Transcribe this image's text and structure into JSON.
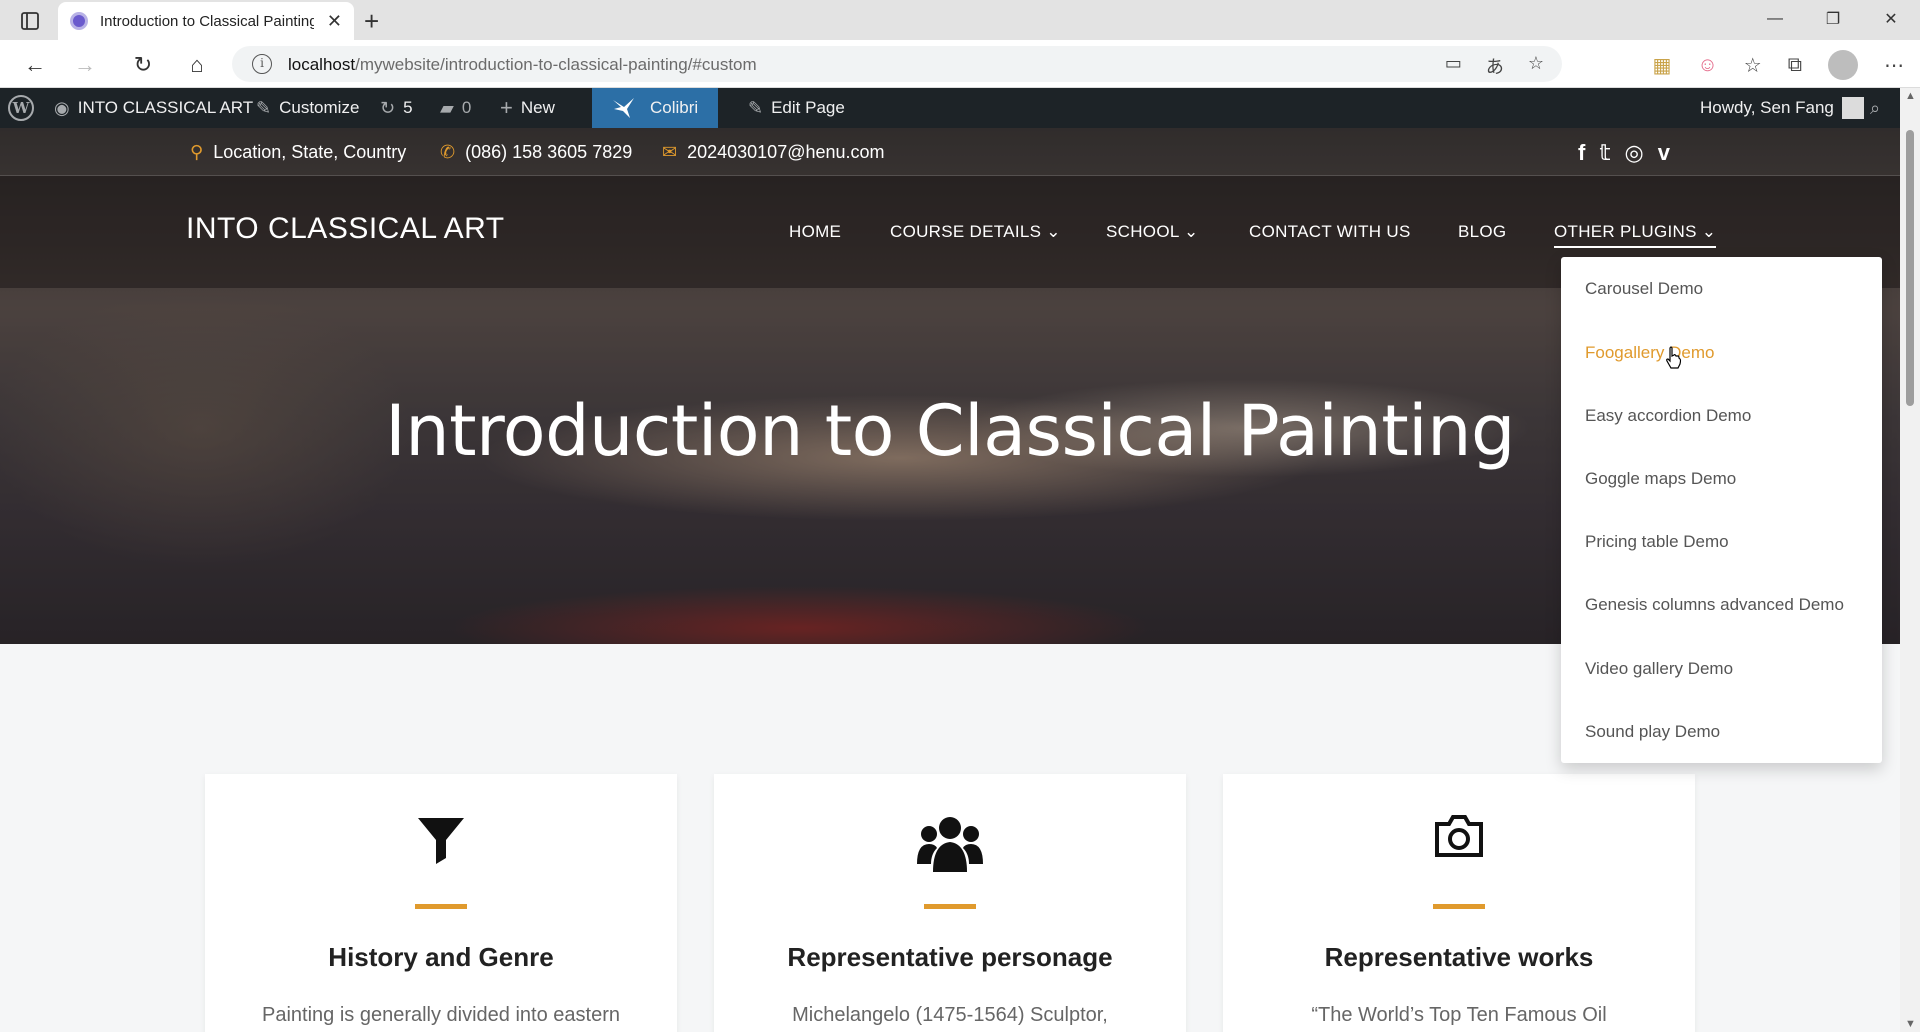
{
  "browser": {
    "tab_title": "Introduction to Classical Painting",
    "url_host": "localhost",
    "url_path": "/mywebsite/introduction-to-classical-painting/#custom"
  },
  "adminbar": {
    "site_name": "INTO CLASSICAL ART",
    "customize": "Customize",
    "updates": "5",
    "comments": "0",
    "new": "New",
    "colibri": "Colibri",
    "edit_page": "Edit Page",
    "howdy": "Howdy, Sen Fang"
  },
  "topinfo": {
    "location": "Location, State, Country",
    "phone": "(086) 158 3605 7829",
    "email": "2024030107@henu.com"
  },
  "site": {
    "title": "INTO CLASSICAL ART",
    "menu": {
      "home": "HOME",
      "course": "COURSE DETAILS",
      "school": "SCHOOL",
      "contact": "CONTACT WITH US",
      "blog": "BLOG",
      "plugins": "OTHER PLUGINS"
    }
  },
  "hero": {
    "title": "Introduction to Classical Painting"
  },
  "dropdown": {
    "items": [
      "Carousel Demo",
      "Foogallery Demo",
      "Easy accordion Demo",
      "Goggle maps Demo",
      "Pricing table Demo",
      "Genesis columns advanced Demo",
      "Video gallery Demo",
      "Sound play Demo"
    ]
  },
  "cards": [
    {
      "title": "History and Genre",
      "text": "Painting is generally divided into eastern",
      "icon": "filter-icon"
    },
    {
      "title": "Representative personage",
      "text": "Michelangelo (1475-1564) Sculptor,",
      "icon": "users-icon"
    },
    {
      "title": "Representative works",
      "text": "“The World’s Top Ten Famous Oil",
      "icon": "camera-icon"
    }
  ],
  "colors": {
    "accent": "#e09a2d",
    "adminbar": "#1d2327",
    "colibri": "#2c6fa6"
  }
}
